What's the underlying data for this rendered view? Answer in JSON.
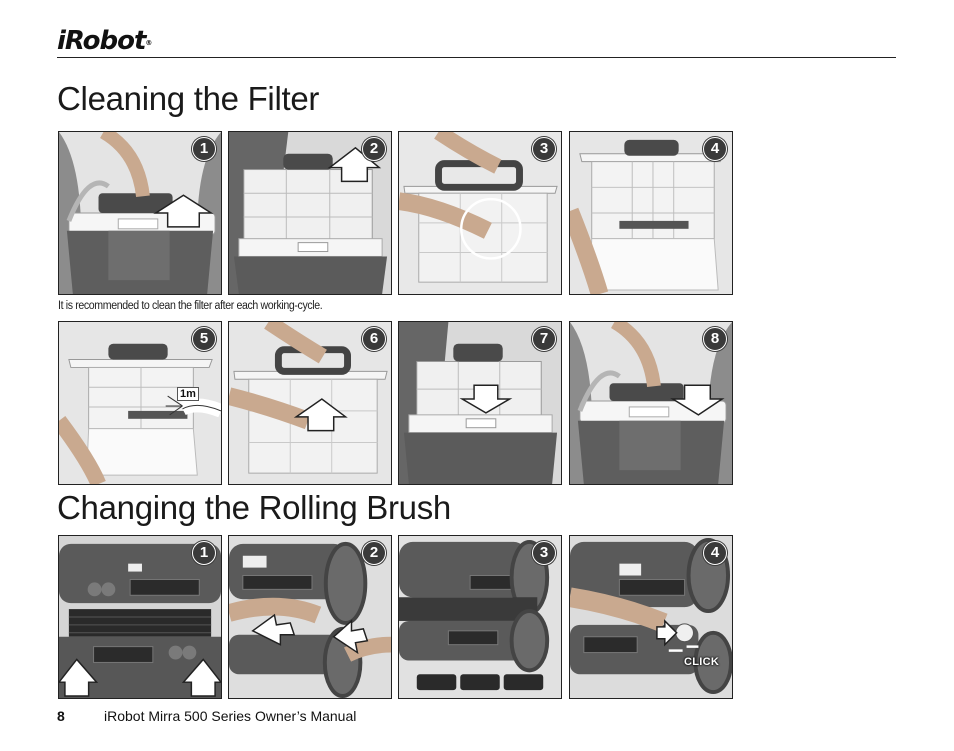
{
  "header": {
    "logo_text": "iRobot",
    "logo_mark": "®"
  },
  "sections": {
    "filter": {
      "title": "Cleaning the Filter",
      "note": "It is recommended to clean the filter after each working-cycle.",
      "steps": [
        {
          "number": "1",
          "scene": "robot-front-lift-filter",
          "arrow": "up"
        },
        {
          "number": "2",
          "scene": "robot-filter-pull-out",
          "arrow": "up"
        },
        {
          "number": "3",
          "scene": "filter-open-latch",
          "highlight": "circle"
        },
        {
          "number": "4",
          "scene": "filter-opened"
        },
        {
          "number": "5",
          "scene": "filter-rinse",
          "label": "1m"
        },
        {
          "number": "6",
          "scene": "filter-close",
          "arrow": "up"
        },
        {
          "number": "7",
          "scene": "robot-filter-insert",
          "arrow": "down"
        },
        {
          "number": "8",
          "scene": "robot-front-lower-filter",
          "arrow": "down"
        }
      ]
    },
    "brush": {
      "title": "Changing the Rolling Brush",
      "steps": [
        {
          "number": "1",
          "scene": "robot-bottom-brushes",
          "arrow": "up"
        },
        {
          "number": "2",
          "scene": "robot-side-remove-brush",
          "arrow": "left"
        },
        {
          "number": "3",
          "scene": "brushes-removed"
        },
        {
          "number": "4",
          "scene": "robot-side-insert-brush",
          "label": "CLICK"
        }
      ]
    }
  },
  "footer": {
    "page_number": "8",
    "title": "iRobot Mirra 500 Series Owner’s Manual"
  }
}
